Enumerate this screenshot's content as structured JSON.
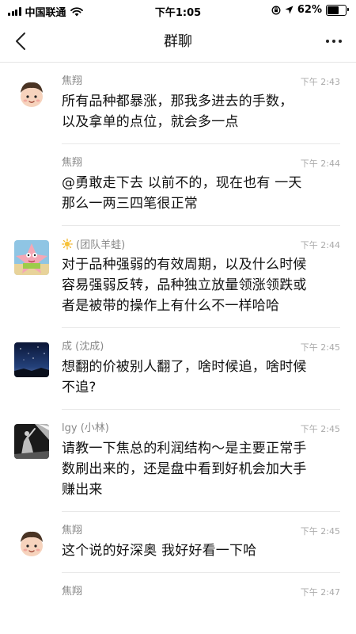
{
  "status_bar": {
    "carrier": "中国联通",
    "time": "下午1:05",
    "battery_label": "62%",
    "battery_level": 0.62
  },
  "nav": {
    "title": "群聊"
  },
  "messages": [
    {
      "sender": "焦翔",
      "time": "下午 2:43",
      "text_lines": [
        "所有品种都暴涨，那我多进去的手数，",
        "以及拿单的点位，就会多一点"
      ]
    },
    {
      "sender": "焦翔",
      "time": "下午 2:44",
      "text_lines": [
        "@勇敢走下去 以前不的，现在也有 一天",
        "那么一两三四笔很正常"
      ]
    },
    {
      "sender": "(团队羊蛙)",
      "time": "下午 2:44",
      "text_lines": [
        "对于品种强弱的有效周期，以及什么时候",
        "容易强弱反转，品种独立放量领涨领跌或",
        "者是被带的操作上有什么不一样哈哈"
      ]
    },
    {
      "sender": "成 (沈成)",
      "time": "下午 2:45",
      "text_lines": [
        "想翻的价被别人翻了，啥时候追，啥时候",
        "不追?"
      ]
    },
    {
      "sender": "lgy (小林)",
      "time": "下午 2:45",
      "text_lines": [
        "请教一下焦总的利润结构～是主要正常手",
        "数刷出来的，还是盘中看到好机会加大手",
        "赚出来"
      ]
    },
    {
      "sender": "焦翔",
      "time": "下午 2:45",
      "text_lines": [
        "这个说的好深奥 我好好看一下哈"
      ]
    },
    {
      "sender": "焦翔",
      "time": "下午 2:47",
      "text_lines": []
    }
  ]
}
